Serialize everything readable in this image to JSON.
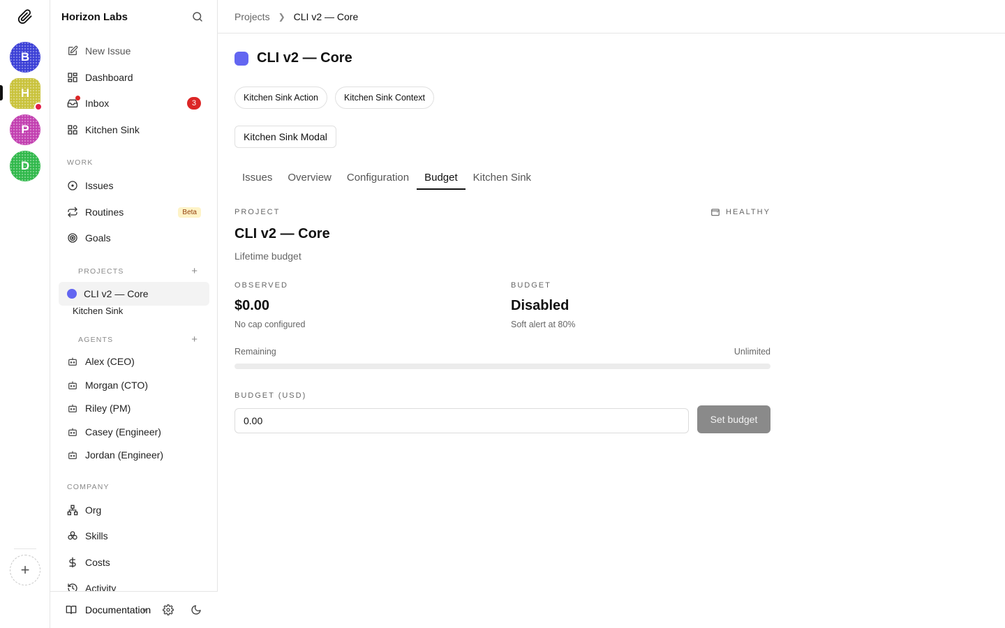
{
  "rail": {
    "workspaces": [
      {
        "letter": "B",
        "color": "#3b3fd6"
      },
      {
        "letter": "H",
        "color": "#c9c23a"
      },
      {
        "letter": "P",
        "color": "#c23fb0"
      },
      {
        "letter": "D",
        "color": "#2fb84a"
      }
    ],
    "add_symbol": "+"
  },
  "sidebar": {
    "org_name": "Horizon Labs",
    "main_items": [
      {
        "label": "New Issue",
        "icon": "edit-icon"
      },
      {
        "label": "Dashboard",
        "icon": "dashboard-icon"
      },
      {
        "label": "Inbox",
        "icon": "inbox-icon",
        "badge": "3"
      },
      {
        "label": "Kitchen Sink",
        "icon": "kitchen-sink-icon"
      }
    ],
    "work_label": "WORK",
    "work_items": [
      {
        "label": "Issues",
        "icon": "issues-icon"
      },
      {
        "label": "Routines",
        "icon": "routines-icon",
        "badge": "Beta"
      },
      {
        "label": "Goals",
        "icon": "goals-icon"
      }
    ],
    "projects_label": "PROJECTS",
    "project_active": "CLI v2 — Core",
    "project_sub": "Kitchen Sink",
    "agents_label": "AGENTS",
    "agents": [
      "Alex (CEO)",
      "Morgan (CTO)",
      "Riley (PM)",
      "Casey (Engineer)",
      "Jordan (Engineer)"
    ],
    "company_label": "COMPANY",
    "company_items": [
      {
        "label": "Org",
        "icon": "org-icon"
      },
      {
        "label": "Skills",
        "icon": "skills-icon"
      },
      {
        "label": "Costs",
        "icon": "dollar-icon"
      },
      {
        "label": "Activity",
        "icon": "history-icon"
      }
    ],
    "footer": {
      "docs_label": "Documentation",
      "version": "v"
    }
  },
  "main": {
    "breadcrumb": {
      "parent": "Projects",
      "current": "CLI v2 — Core"
    },
    "title": "CLI v2 — Core",
    "project_color": "#6366f1",
    "chips": [
      "Kitchen Sink Action",
      "Kitchen Sink Context"
    ],
    "modal_button": "Kitchen Sink Modal",
    "tabs": [
      "Issues",
      "Overview",
      "Configuration",
      "Budget",
      "Kitchen Sink"
    ],
    "active_tab": "Budget",
    "budget": {
      "project_label": "PROJECT",
      "health_label": "HEALTHY",
      "project_name": "CLI v2 — Core",
      "subtitle": "Lifetime budget",
      "observed_label": "OBSERVED",
      "observed_value": "$0.00",
      "observed_note": "No cap configured",
      "budget_label": "BUDGET",
      "budget_value": "Disabled",
      "budget_note": "Soft alert at 80%",
      "remaining_label": "Remaining",
      "remaining_value": "Unlimited",
      "progress_fraction": 0,
      "usd_label": "BUDGET (USD)",
      "input_value": "0.00",
      "set_button": "Set budget"
    }
  }
}
